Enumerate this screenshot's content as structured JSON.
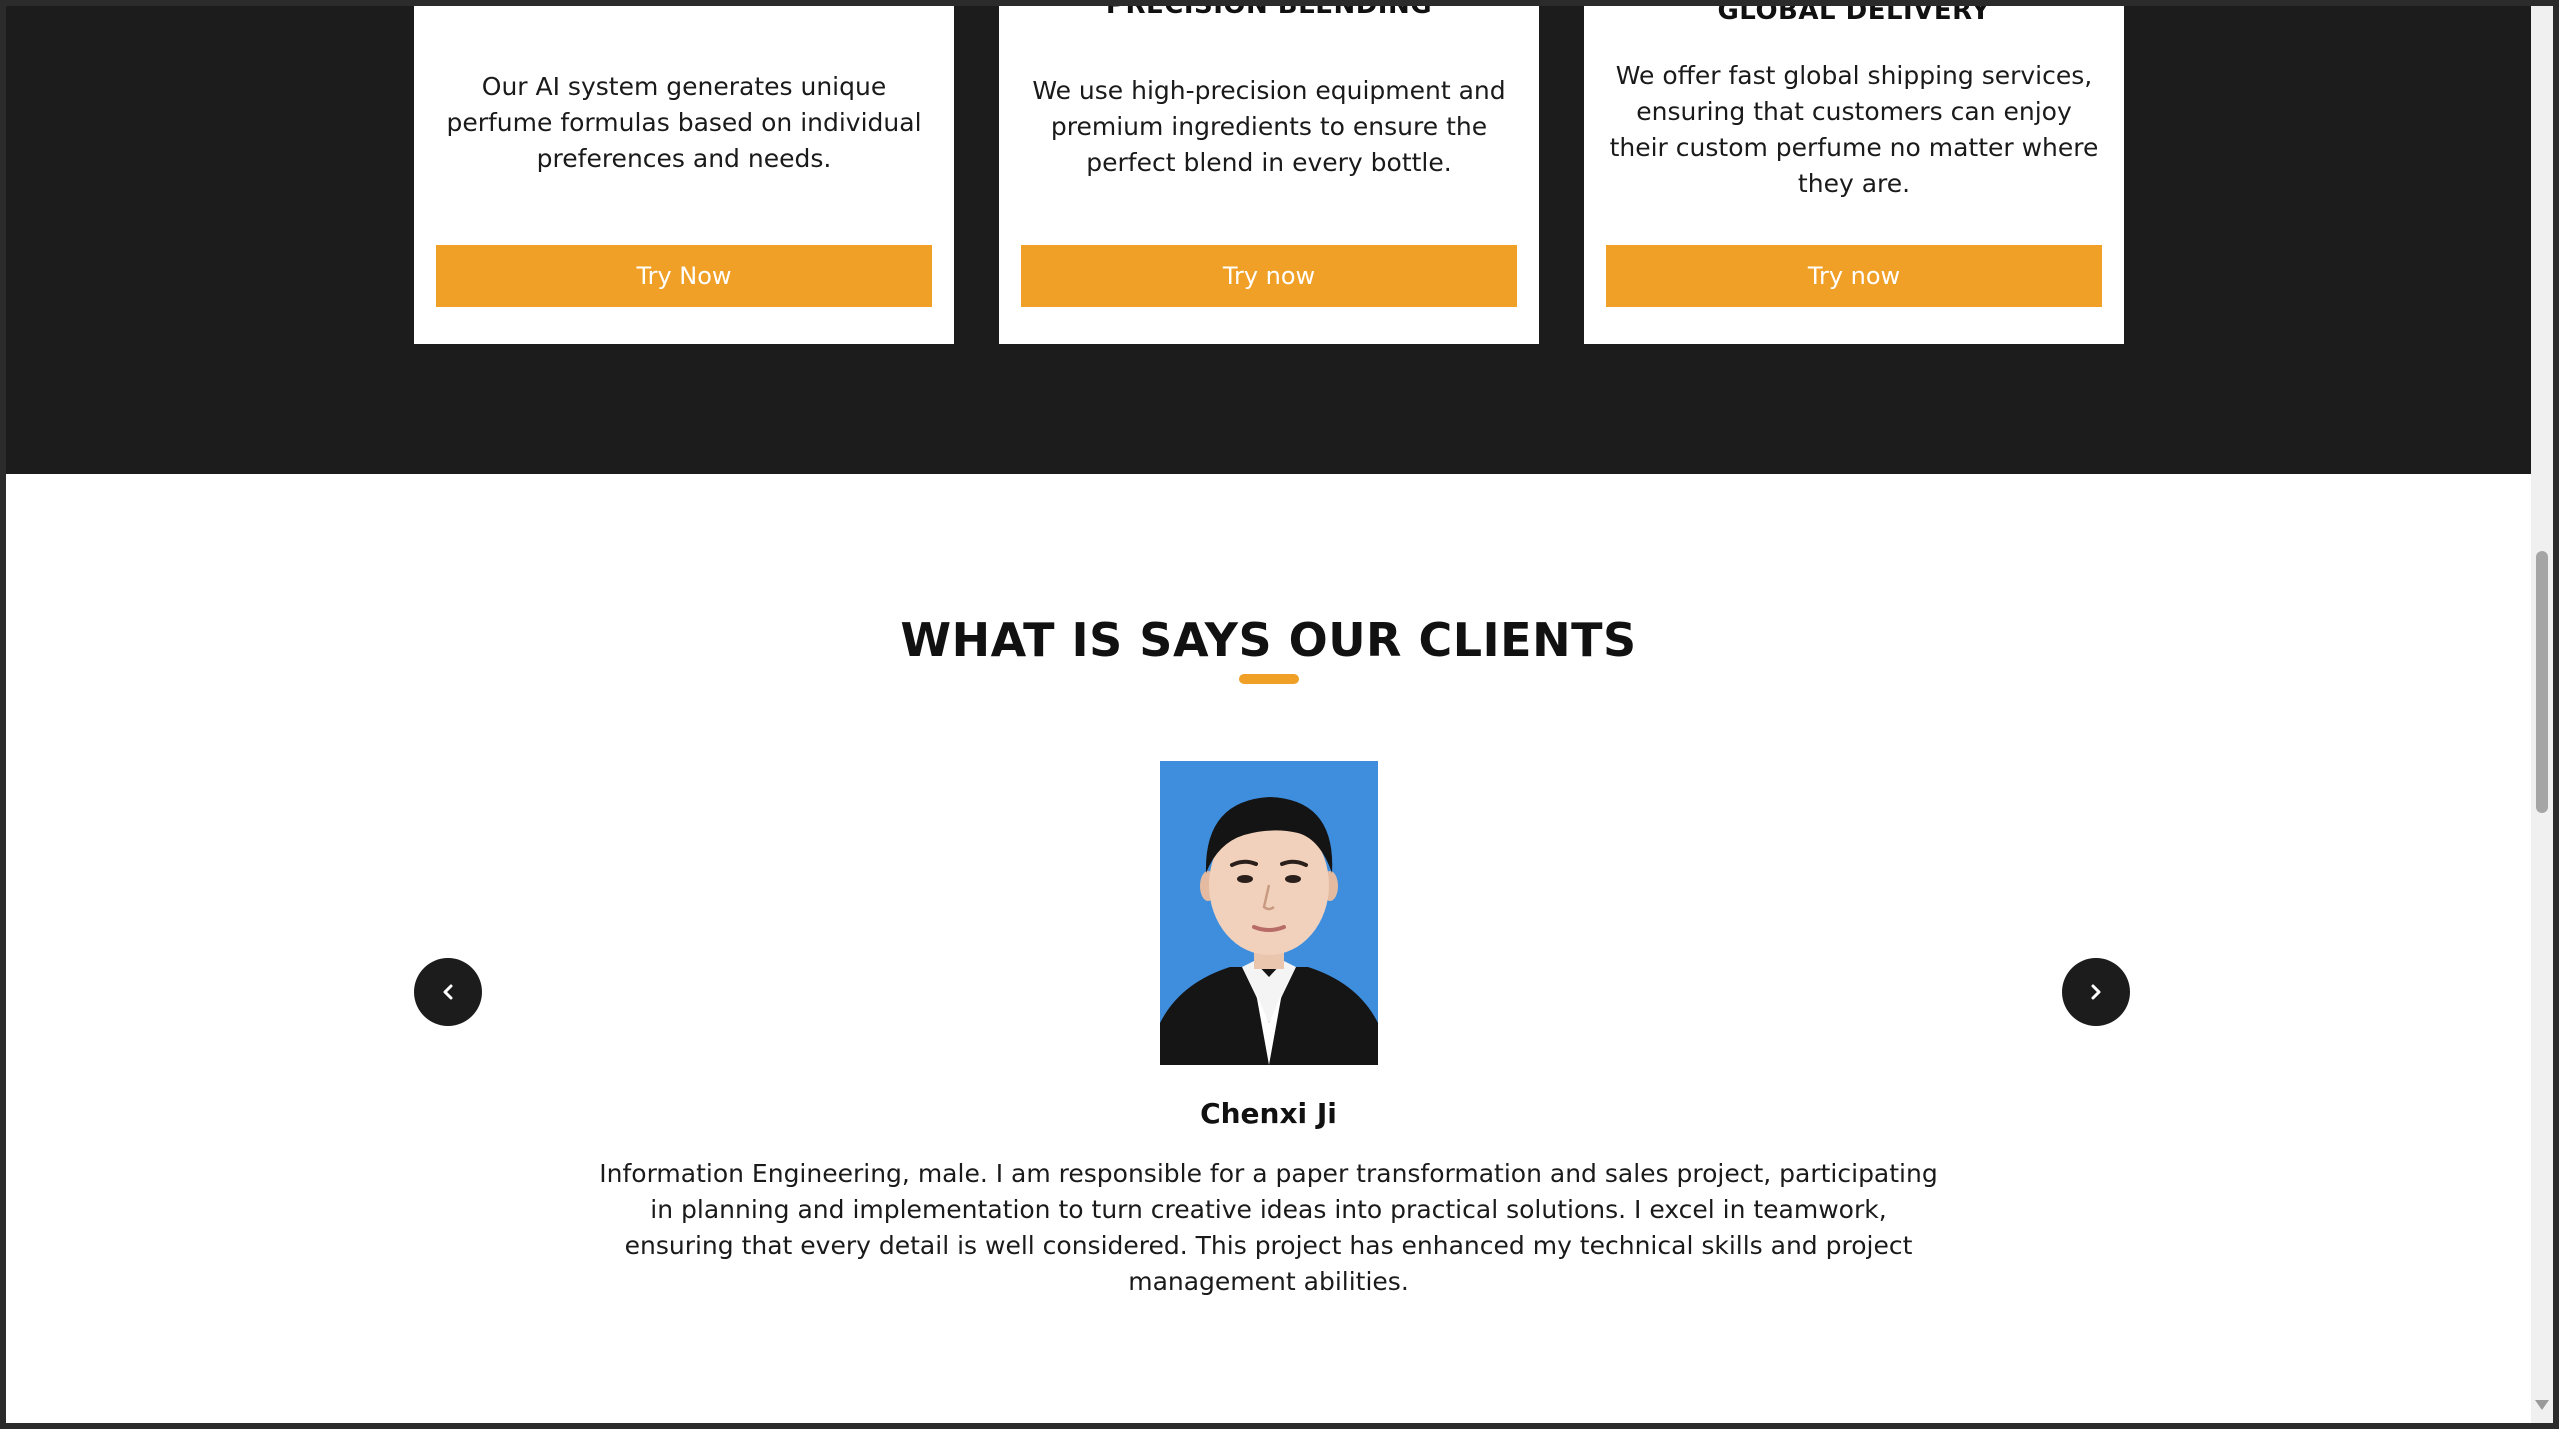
{
  "features": {
    "cards": [
      {
        "title": "",
        "text": "Our AI system generates unique perfume formulas based on individual preferences and needs.",
        "button": "Try Now"
      },
      {
        "title": "PRECISION BLENDING",
        "text": "We use high-precision equipment and premium ingredients to ensure the perfect blend in every bottle.",
        "button": "Try now"
      },
      {
        "title": "GLOBAL DELIVERY",
        "text": "We offer fast global shipping services, ensuring that customers can enjoy their custom perfume no matter where they are.",
        "button": "Try now"
      }
    ],
    "accent_color": "#f0a026",
    "background_color": "#1c1c1c"
  },
  "testimonials": {
    "title": "WHAT IS SAYS OUR CLIENTS",
    "client": {
      "name": "Chenxi Ji",
      "quote": "Information Engineering, male. I am responsible for a paper transformation and sales project, participating in planning and implementation to turn creative ideas into practical solutions. I excel in teamwork, ensuring that every detail is well considered. This project has enhanced my technical skills and project management abilities.",
      "photo_background": "#3f8ede"
    },
    "prev_icon": "chevron-left-icon",
    "next_icon": "chevron-right-icon"
  }
}
